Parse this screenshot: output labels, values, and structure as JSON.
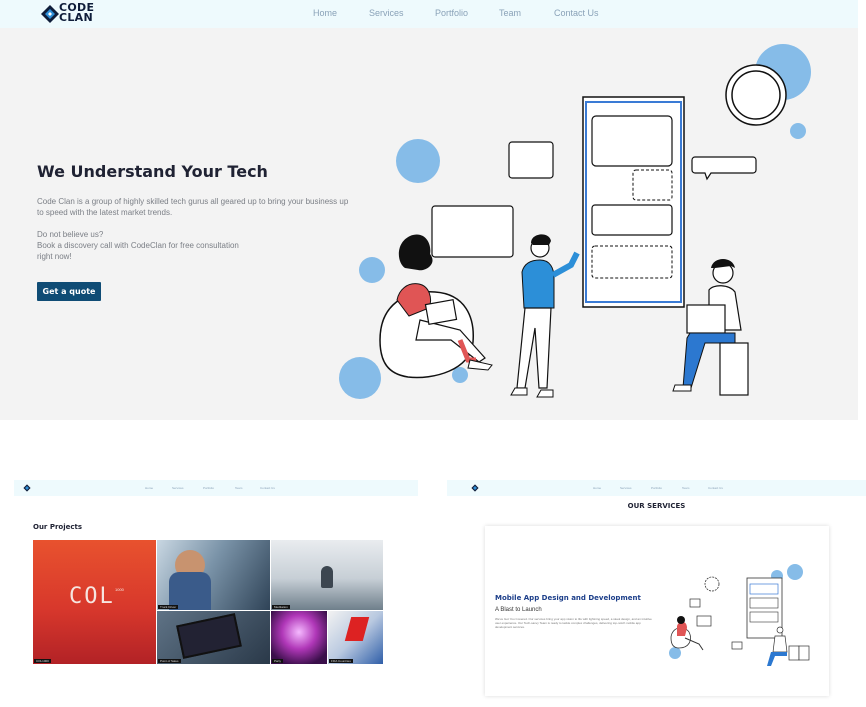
{
  "hero_page": {
    "logo": {
      "line1": "CODE",
      "line2": "CLAN"
    },
    "nav": [
      "Home",
      "Services",
      "Portfolio",
      "Team",
      "Contact Us"
    ],
    "title": "We Understand Your Tech",
    "description": "Code Clan is a group of highly skilled tech gurus all geared up to bring your business up to speed with the latest market trends.",
    "cta_lines": [
      "Do not believe us?",
      "Book a discovery call with CodeClan for free consultation",
      "right now!"
    ],
    "quote_button": "Get a quote"
  },
  "projects_page": {
    "nav": [
      "Home",
      "Services",
      "Portfolio",
      "Team",
      "Contact Us"
    ],
    "title": "Our Projects",
    "tiles": [
      {
        "caption": "COL1000",
        "logo_text": "COL",
        "logo_sup": "1000"
      },
      {
        "caption": "Truck Driver"
      },
      {
        "caption": "Meditation"
      },
      {
        "caption": "Point of Sales"
      },
      {
        "caption": "Party"
      },
      {
        "caption": "FIFA Countries"
      }
    ]
  },
  "services_page": {
    "nav": [
      "Home",
      "Services",
      "Portfolio",
      "Team",
      "Contact Us"
    ],
    "title": "OUR SERVICES",
    "card_title": "Mobile App Design and Development",
    "card_subtitle": "A Blast to Launch",
    "card_text": "We've Got You Covered. Our services bring your app vision to life with lightning speed, a sleek design, and an intuitive user experience. Our Tech-savvy Team is ready to tackle complex challenges, delivering top-notch mobile app development services."
  },
  "colors": {
    "navy": "#0f4c75",
    "accent_blue": "#7fb6e6",
    "nav_bg": "#eefafd"
  }
}
